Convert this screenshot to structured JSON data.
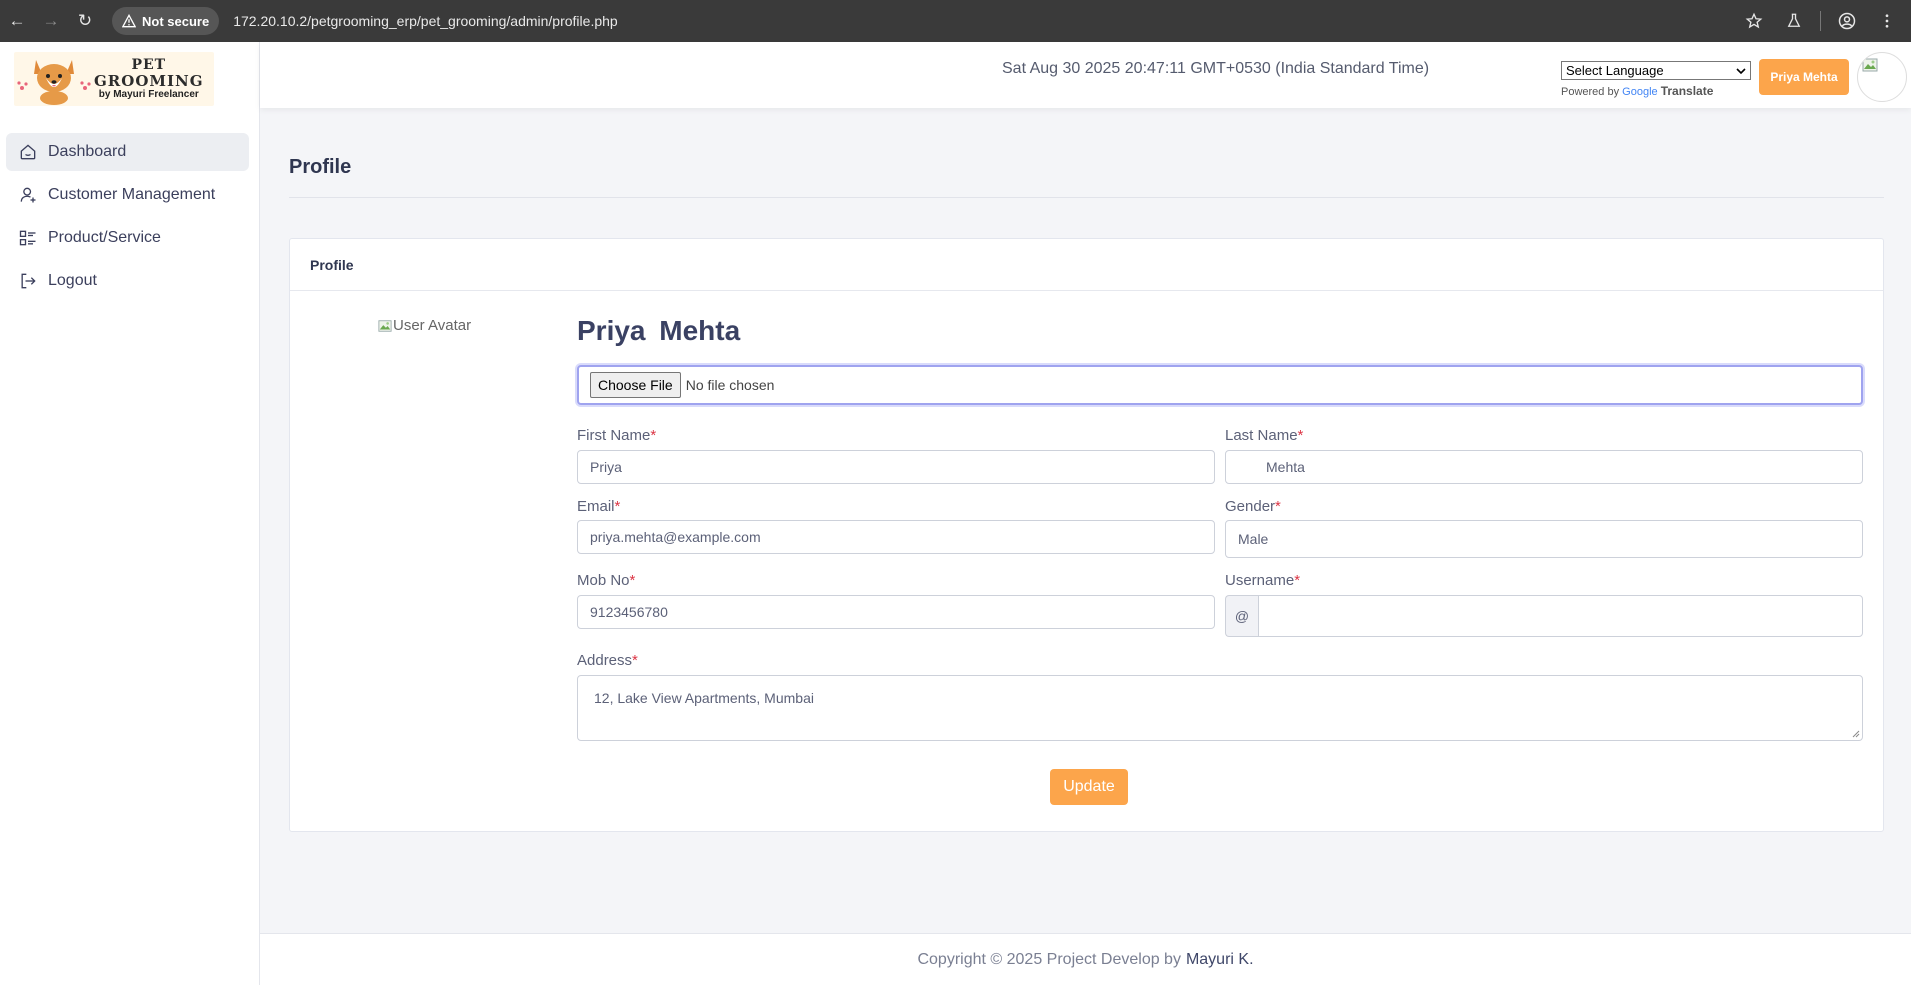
{
  "browser": {
    "security_label": "Not secure",
    "url": "172.20.10.2/petgrooming_erp/pet_grooming/admin/profile.php"
  },
  "logo": {
    "line1": "PET",
    "line2": "GROOMING",
    "line3": "by Mayuri Freelancer"
  },
  "sidebar": {
    "items": [
      {
        "label": "Dashboard",
        "icon": "home-icon",
        "active": true
      },
      {
        "label": "Customer Management",
        "icon": "user-plus-icon"
      },
      {
        "label": "Product/Service",
        "icon": "list-icon"
      },
      {
        "label": "Logout",
        "icon": "logout-icon"
      }
    ]
  },
  "header": {
    "clock": "Sat Aug 30 2025 20:47:11 GMT+0530 (India Standard Time)",
    "language_select": "Select Language",
    "powered_by": "Powered by",
    "google": "Google",
    "translate": "Translate",
    "user_button": "Priya Mehta"
  },
  "page": {
    "title": "Profile",
    "card_title": "Profile",
    "avatar_alt": "User Avatar",
    "name_first": "Priya",
    "name_last": "Mehta"
  },
  "file_input": {
    "button": "Choose File",
    "status": "No file chosen"
  },
  "form": {
    "first_name": {
      "label": "First Name",
      "value": "Priya"
    },
    "last_name": {
      "label": "Last Name",
      "value": "Mehta"
    },
    "email": {
      "label": "Email",
      "value": "priya.mehta@example.com"
    },
    "gender": {
      "label": "Gender",
      "value": "Male"
    },
    "mobile": {
      "label": "Mob No",
      "value": "9123456780"
    },
    "username": {
      "label": "Username",
      "prefix": "@",
      "value": ""
    },
    "address": {
      "label": "Address",
      "value": "12, Lake View Apartments, Mumbai"
    },
    "required_mark": "*",
    "submit": "Update"
  },
  "footer": {
    "text": "Copyright © 2025 Project Develop by",
    "author": "Mayuri K."
  },
  "colors": {
    "accent": "#fca54b",
    "text_dark": "#3a4163",
    "required": "#dc3545"
  }
}
